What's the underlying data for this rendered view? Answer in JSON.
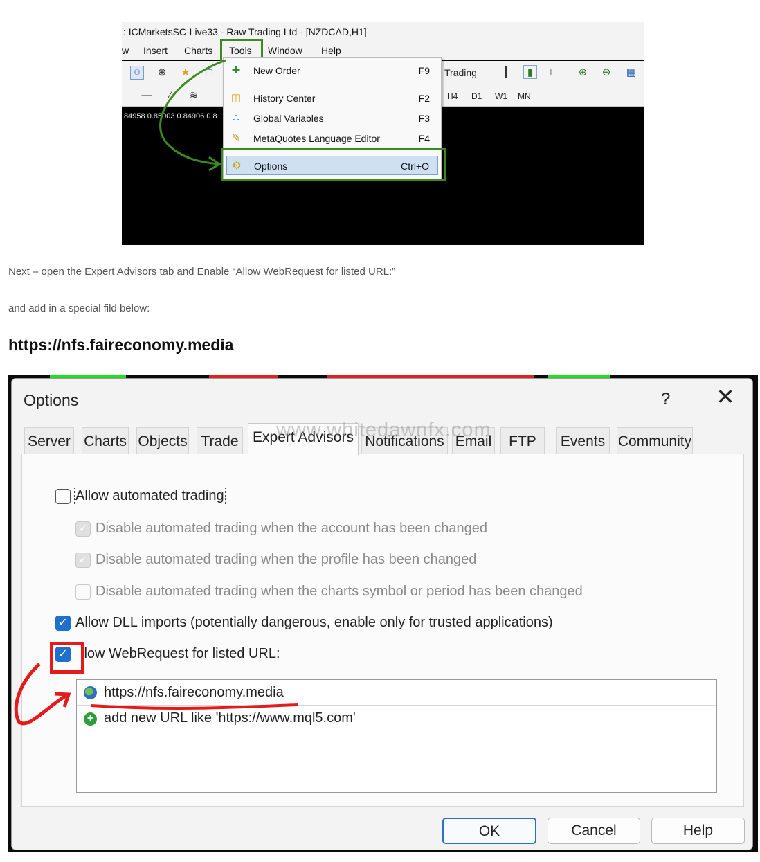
{
  "shot1": {
    "title": ": ICMarketsSC-Live33 - Raw Trading Ltd - [NZDCAD,H1]",
    "menu": [
      "w",
      "Insert",
      "Charts",
      "Tools",
      "Window",
      "Help"
    ],
    "toolbar_trading_label": "Trading",
    "timeframes": [
      "H4",
      "D1",
      "W1",
      "MN"
    ],
    "prices": ".84958 0.85003 0.84906 0.8",
    "dropdown": [
      {
        "label": "New Order",
        "shortcut": "F9",
        "icon": "new-order-icon"
      },
      {
        "label": "History Center",
        "shortcut": "F2",
        "icon": "history-center-icon"
      },
      {
        "label": "Global Variables",
        "shortcut": "F3",
        "icon": "global-variables-icon"
      },
      {
        "label": "MetaQuotes Language Editor",
        "shortcut": "F4",
        "icon": "metaeditor-icon"
      },
      {
        "label": "Options",
        "shortcut": "Ctrl+O",
        "icon": "options-gear-icon"
      }
    ],
    "highlight_color": "#3d8b1e"
  },
  "text": {
    "para1": "Next – open the Expert Advisors tab and Enable “Allow WebRequest for listed URL:”",
    "para2": "and add in a special fild below:",
    "url_heading": "https://nfs.faireconomy.media"
  },
  "dialog": {
    "title": "Options",
    "help": "?",
    "close": "✕",
    "watermark": "www.whitedawnfx.com",
    "tabs": [
      "Server",
      "Charts",
      "Objects",
      "Trade",
      "Expert Advisors",
      "Notifications",
      "Email",
      "FTP",
      "Events",
      "Community"
    ],
    "active_tab": "Expert Advisors",
    "options": [
      {
        "label": "Allow automated trading",
        "checked": false,
        "enabled": true
      },
      {
        "label": "Disable automated trading when the account has been changed",
        "checked": true,
        "enabled": false
      },
      {
        "label": "Disable automated trading when the profile has been changed",
        "checked": true,
        "enabled": false
      },
      {
        "label": "Disable automated trading when the charts symbol or period has been changed",
        "checked": false,
        "enabled": false
      },
      {
        "label": "Allow DLL imports (potentially dangerous, enable only for trusted applications)",
        "checked": true,
        "enabled": true
      },
      {
        "label": "llow WebRequest for listed URL:",
        "checked": true,
        "enabled": true
      }
    ],
    "url_list": {
      "entry": "https://nfs.faireconomy.media",
      "add_hint": "add new URL like 'https://www.mql5.com'"
    },
    "buttons": {
      "ok": "OK",
      "cancel": "Cancel",
      "help": "Help"
    },
    "accent_color": "#1e6fce",
    "annotation_color": "#e41b1b"
  }
}
